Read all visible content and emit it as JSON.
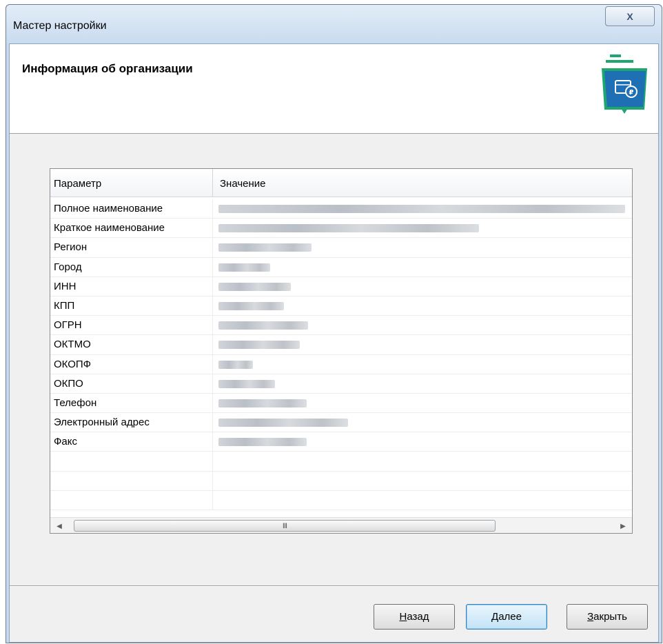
{
  "window": {
    "title": "Мастер настройки",
    "close_label": "X"
  },
  "header": {
    "title": "Информация об организации",
    "logo_icon": "folder-ruble-icon"
  },
  "grid": {
    "columns": [
      "Параметр",
      "Значение"
    ],
    "rows": [
      {
        "param": "Полное наименование"
      },
      {
        "param": "Краткое наименование"
      },
      {
        "param": "Регион"
      },
      {
        "param": "Город"
      },
      {
        "param": "ИНН"
      },
      {
        "param": "КПП"
      },
      {
        "param": "ОГРН"
      },
      {
        "param": "ОКТМО"
      },
      {
        "param": "ОКОПФ"
      },
      {
        "param": "ОКПО"
      },
      {
        "param": "Телефон"
      },
      {
        "param": "Электронный адрес"
      },
      {
        "param": "Факс"
      }
    ],
    "scroll_thumb_label": "III"
  },
  "buttons": {
    "back": {
      "mnemonic": "Н",
      "rest": "азад"
    },
    "next": {
      "mnemonic": "Д",
      "rest": "алее"
    },
    "close": {
      "mnemonic": "З",
      "rest": "акрыть"
    }
  },
  "colors": {
    "accent": "#1da76f",
    "logo_blue": "#1f6fb5"
  }
}
